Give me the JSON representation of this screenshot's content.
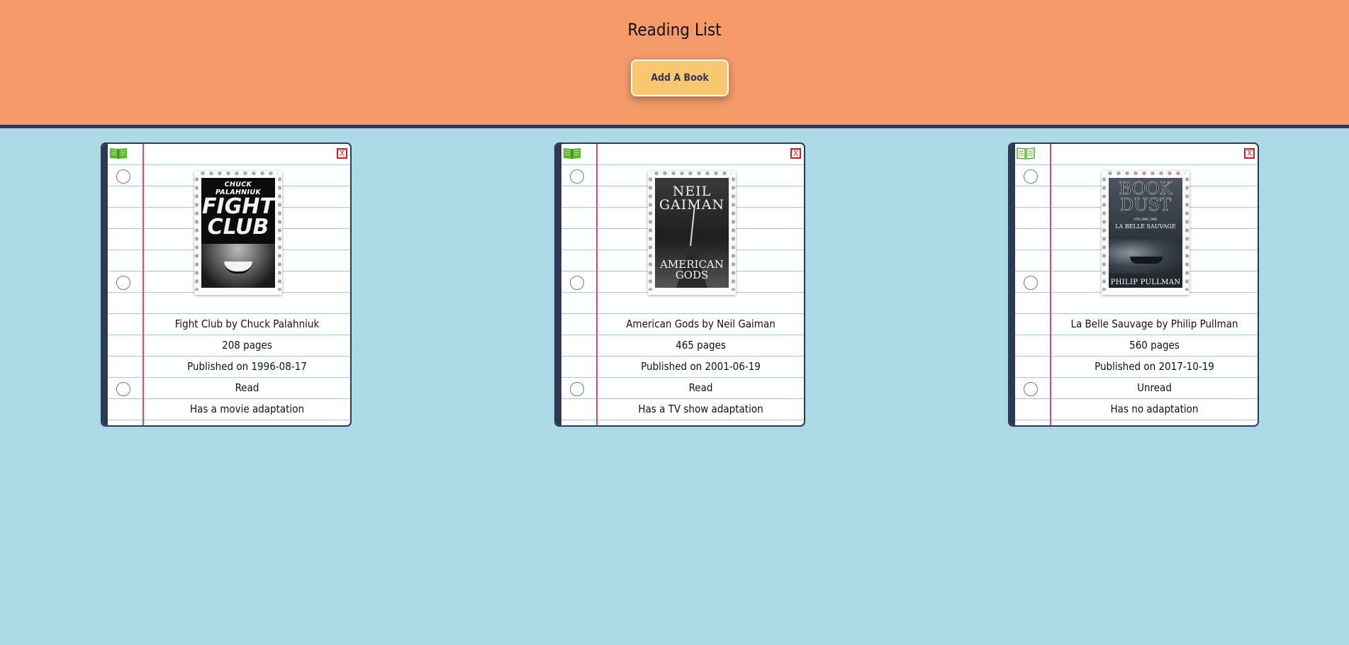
{
  "header": {
    "title": "Reading List",
    "add_button_label": "Add A Book",
    "background_color": "#f49b69",
    "button_color": "#f8c76f"
  },
  "books": [
    {
      "read_icon": "book-closed-icon",
      "delete_label": "X",
      "cover": {
        "author_text": "CHUCK PALAHNIUK",
        "title_line1": "FIGHT",
        "title_line2": "CLUB"
      },
      "title_line": "Fight Club by Chuck Palahniuk",
      "pages": "208 pages",
      "published": "Published on 1996-08-17",
      "status": "Read",
      "adaptation": "Has a movie adaptation"
    },
    {
      "read_icon": "book-closed-icon",
      "delete_label": "X",
      "cover": {
        "author_line1": "NEIL",
        "author_line2": "GAIMAN",
        "title_line1": "AMERICAN",
        "title_line2": "GODS"
      },
      "title_line": "American Gods by Neil Gaiman",
      "pages": "465 pages",
      "published": "Published on 2001-06-19",
      "status": "Read",
      "adaptation": "Has a TV show adaptation"
    },
    {
      "read_icon": "book-open-icon",
      "delete_label": "X",
      "cover": {
        "title_line1": "BOOK",
        "title_line2": "DUST",
        "volume": "VOLUME ONE",
        "subtitle": "LA BELLE SAUVAGE",
        "author_text": "PHILIP PULLMAN"
      },
      "title_line": "La Belle Sauvage by Philip Pullman",
      "pages": "560 pages",
      "published": "Published on 2017-10-19",
      "status": "Unread",
      "adaptation": "Has no adaptation"
    }
  ]
}
